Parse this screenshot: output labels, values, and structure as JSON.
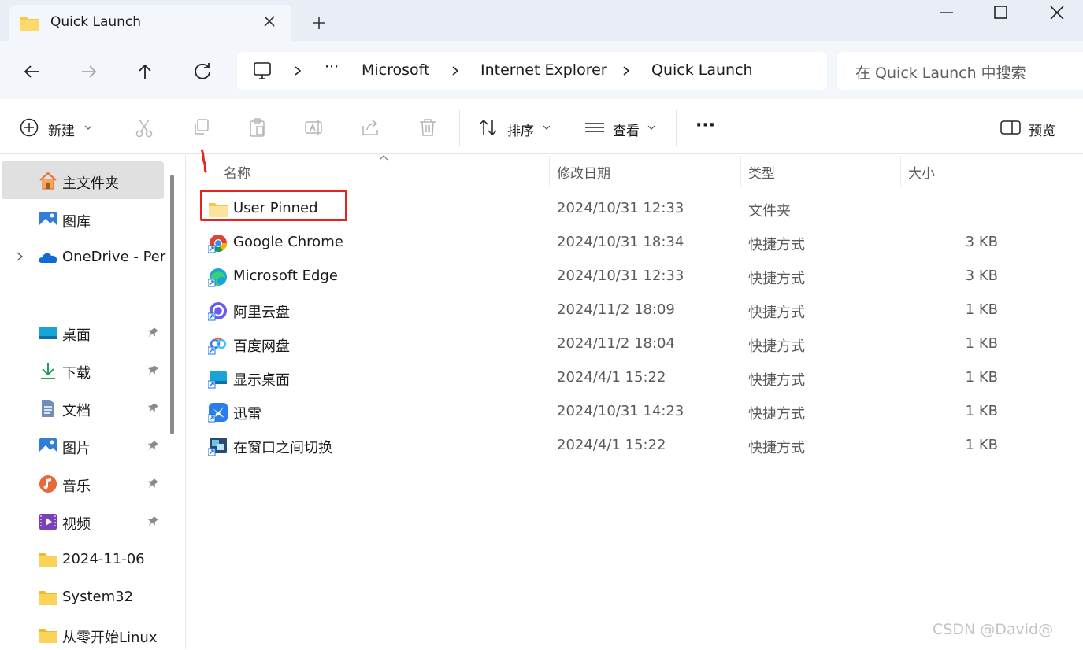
{
  "window": {
    "tab_title": "Quick Launch",
    "new_tab": "+"
  },
  "breadcrumb": {
    "overflow": "···",
    "items": [
      "Microsoft",
      "Internet Explorer",
      "Quick Launch"
    ]
  },
  "search": {
    "placeholder": "在 Quick Launch 中搜索"
  },
  "toolbar": {
    "new_label": "新建",
    "sort_label": "排序",
    "view_label": "查看",
    "more_label": "···",
    "preview_label": "预览"
  },
  "sidebar": {
    "home": "主文件夹",
    "gallery": "图库",
    "onedrive": "OneDrive - Per",
    "pinned": [
      {
        "label": "桌面",
        "icon": "desktop-icon"
      },
      {
        "label": "下载",
        "icon": "download-icon"
      },
      {
        "label": "文档",
        "icon": "document-icon"
      },
      {
        "label": "图片",
        "icon": "pictures-icon"
      },
      {
        "label": "音乐",
        "icon": "music-icon"
      },
      {
        "label": "视频",
        "icon": "video-icon"
      }
    ],
    "folders": [
      "2024-11-06",
      "System32",
      "从零开始Linux"
    ]
  },
  "columns": {
    "name": "名称",
    "date": "修改日期",
    "type": "类型",
    "size": "大小"
  },
  "files": [
    {
      "name": "User Pinned",
      "date": "2024/10/31 12:33",
      "type": "文件夹",
      "size": "",
      "icon": "folder-icon"
    },
    {
      "name": "Google Chrome",
      "date": "2024/10/31 18:34",
      "type": "快捷方式",
      "size": "3 KB",
      "icon": "chrome-icon"
    },
    {
      "name": "Microsoft Edge",
      "date": "2024/10/31 12:33",
      "type": "快捷方式",
      "size": "3 KB",
      "icon": "edge-icon"
    },
    {
      "name": "阿里云盘",
      "date": "2024/11/2 18:09",
      "type": "快捷方式",
      "size": "1 KB",
      "icon": "aliyun-drive-icon"
    },
    {
      "name": "百度网盘",
      "date": "2024/11/2 18:04",
      "type": "快捷方式",
      "size": "1 KB",
      "icon": "baidu-netdisk-icon"
    },
    {
      "name": "显示桌面",
      "date": "2024/4/1 15:22",
      "type": "快捷方式",
      "size": "1 KB",
      "icon": "show-desktop-icon"
    },
    {
      "name": "迅雷",
      "date": "2024/10/31 14:23",
      "type": "快捷方式",
      "size": "1 KB",
      "icon": "xunlei-icon"
    },
    {
      "name": "在窗口之间切换",
      "date": "2024/4/1 15:22",
      "type": "快捷方式",
      "size": "1 KB",
      "icon": "switch-windows-icon"
    }
  ],
  "watermark": "CSDN @David@",
  "colors": {
    "titlebar": "#e9eef6",
    "addressbar_row": "#f3f6fb",
    "highlight_box": "#e8231f",
    "selected_sidebar": "#e0e0e0"
  }
}
